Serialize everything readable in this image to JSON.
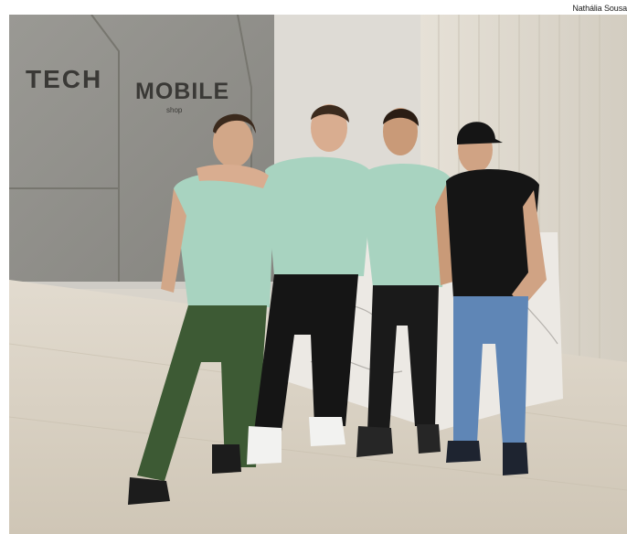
{
  "photo_credit": "Nathália Sousa",
  "scene": {
    "wall_sign_line1": "TECH",
    "wall_sign_line2": "MOBILE",
    "wall_sign_sub": "shop"
  },
  "colors": {
    "concrete_wall": "#8f8e89",
    "wood_panel": "#dcd6ca",
    "floor": "#d7cfc1",
    "shirt_mint": "#a8d3c0",
    "shirt_black": "#151515",
    "jeans_blue": "#5f86b6",
    "pants_olive": "#3d5a34",
    "pants_black": "#1a1a1a"
  }
}
